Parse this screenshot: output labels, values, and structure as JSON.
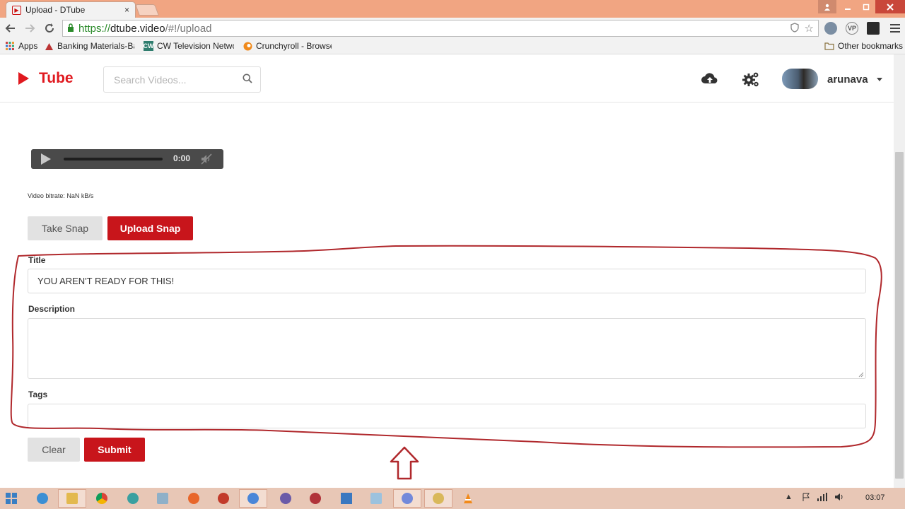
{
  "browser": {
    "tab_title": "Upload - DTube",
    "tab_close": "×",
    "url": {
      "scheme": "https://",
      "domain": "dtube.video",
      "path": "/#!/upload"
    },
    "extensions": [
      "VP"
    ],
    "bookmarks": [
      {
        "label": "Apps",
        "icon": "apps-grid-icon"
      },
      {
        "label": "Banking Materials-Bai",
        "icon": "bank-icon"
      },
      {
        "label": "CW Television Netwo",
        "icon": "cw-icon",
        "icon_text": "CW"
      },
      {
        "label": "Crunchyroll - Browse",
        "icon": "crunchyroll-icon"
      }
    ],
    "other_bookmarks": "Other bookmarks"
  },
  "header": {
    "logo_text": "Tube",
    "search_placeholder": "Search Videos...",
    "username": "arunava"
  },
  "player": {
    "time": "0:00",
    "progress": 0
  },
  "bitrate_text": "Video bitrate: NaN kB/s",
  "snap_buttons": {
    "take": "Take Snap",
    "upload": "Upload Snap"
  },
  "form": {
    "title_label": "Title",
    "title_value": "YOU AREN'T READY FOR THIS!",
    "description_label": "Description",
    "description_value": "",
    "tags_label": "Tags",
    "tags_value": ""
  },
  "actions": {
    "clear": "Clear",
    "submit": "Submit"
  },
  "colors": {
    "brand_red": "#c8151b",
    "logo_red": "#e0191f",
    "annotation_red": "#b0282c"
  },
  "taskbar": {
    "time": "03:07"
  }
}
